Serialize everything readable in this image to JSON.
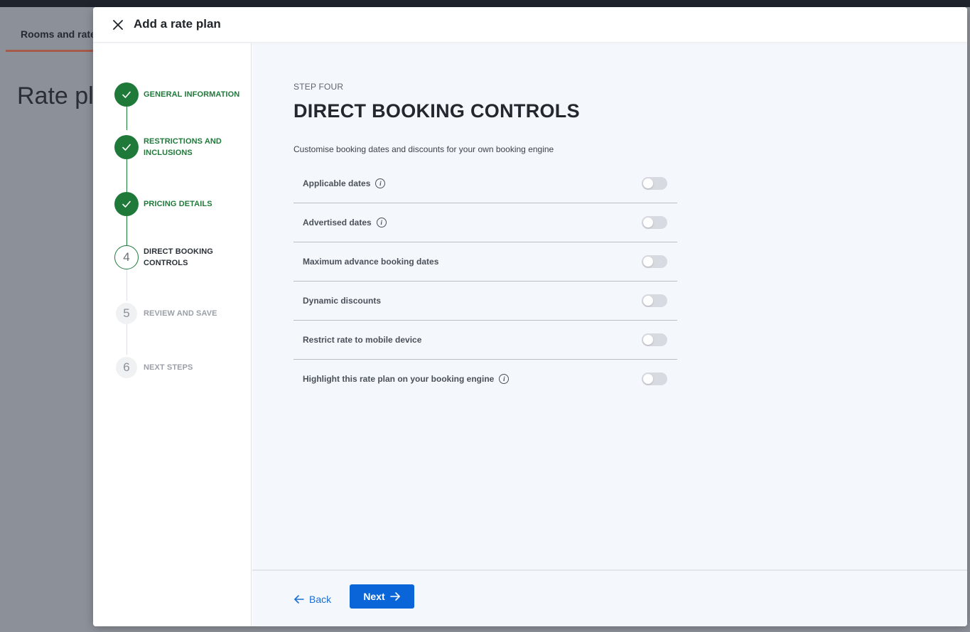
{
  "background": {
    "tab_label": "Rooms and rates",
    "page_title": "Rate plans"
  },
  "modal": {
    "title": "Add a rate plan"
  },
  "stepper": {
    "steps": [
      {
        "number": "1",
        "label": "General information",
        "status": "done"
      },
      {
        "number": "2",
        "label": "Restrictions and inclusions",
        "status": "done"
      },
      {
        "number": "3",
        "label": "Pricing details",
        "status": "done"
      },
      {
        "number": "4",
        "label": "Direct booking controls",
        "status": "current"
      },
      {
        "number": "5",
        "label": "Review and save",
        "status": "todo"
      },
      {
        "number": "6",
        "label": "Next steps",
        "status": "todo"
      }
    ]
  },
  "content": {
    "kicker": "STEP FOUR",
    "heading": "DIRECT BOOKING CONTROLS",
    "description": "Customise booking dates and discounts for your own booking engine",
    "controls": [
      {
        "label": "Applicable dates",
        "info": true,
        "enabled": false
      },
      {
        "label": "Advertised dates",
        "info": true,
        "enabled": false
      },
      {
        "label": "Maximum advance booking dates",
        "info": false,
        "enabled": false
      },
      {
        "label": "Dynamic discounts",
        "info": false,
        "enabled": false
      },
      {
        "label": "Restrict rate to mobile device",
        "info": false,
        "enabled": false
      },
      {
        "label": "Highlight this rate plan on your booking engine",
        "info": true,
        "enabled": false
      }
    ]
  },
  "footer": {
    "back_label": "Back",
    "next_label": "Next"
  },
  "colors": {
    "success_green": "#1f7a3a",
    "primary_blue": "#0a66d8",
    "link_blue": "#1a6fd4"
  }
}
